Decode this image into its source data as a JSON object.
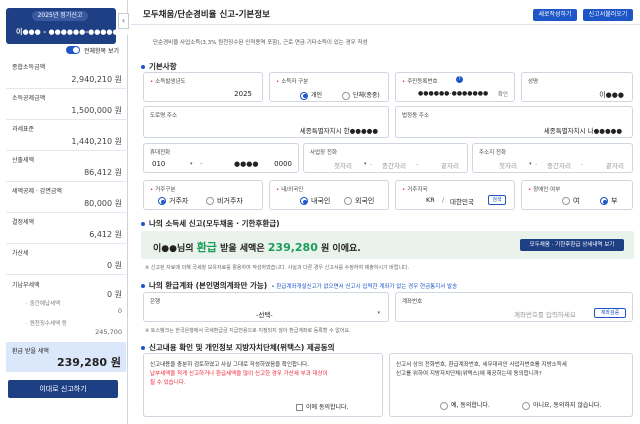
{
  "sidebar": {
    "period_badge": "2025년 정기신고",
    "user_masked": "이●●● - ●●●●●●-●●●●●●●",
    "collapse_icon": "‹",
    "toggle_label": "전체항목 보기",
    "items": [
      {
        "label": "종합소득금액",
        "value": "2,940,210 원"
      },
      {
        "label": "소득공제금액",
        "value": "1,500,000 원"
      },
      {
        "label": "과세표준",
        "value": "1,440,210 원"
      },
      {
        "label": "산출세액",
        "value": "86,412 원"
      },
      {
        "label": "세액공제 · 감면금액",
        "value": "80,000 원"
      },
      {
        "label": "결정세액",
        "value": "6,412 원"
      },
      {
        "label": "가산세",
        "value": "0 원"
      }
    ],
    "prepaid": {
      "label": "기납부세액",
      "value": "0 원",
      "sub1_label": "중간예납세액",
      "sub1_value": "0",
      "sub2_label": "원천징수세액 등",
      "sub2_value": "245,700"
    },
    "refund_label": "환급 받을 세액",
    "refund_value": "239,280 원",
    "submit_label": "이대로 신고하기"
  },
  "header": {
    "title": "모두채움/단순경비율 신고-기본정보",
    "btn_rewrite": "새로작성하기",
    "btn_load": "신고서불러오기"
  },
  "description": "단순경비율 사업소득(3.3% 원천징수된 인적용역 포함), 근로·연금·기타소득이 있는 경우 작성",
  "basic": {
    "section_title": "기본사항",
    "year_label": "소득발생년도",
    "year_value": "2025",
    "filer_type_label": "소득자 구분",
    "filer_type_options": [
      "개인",
      "단체(종중)"
    ],
    "rrn_label": "주민등록번호",
    "rrn_value": "●●●●●●-●●●●●●●",
    "rrn_confirm": "확인",
    "name_label": "성명",
    "name_value": "이●●●",
    "road_addr_label": "도로명 주소",
    "road_addr_value": "세종특별자치시 한●●●●●",
    "legal_addr_label": "법정동 주소",
    "legal_addr_value": "세종특별자치시 나●●●●●",
    "mobile_label": "휴대전화",
    "mobile_p1": "010",
    "mobile_p2": "●●●●",
    "mobile_p3": "0000",
    "biz_phone_label": "사업장 전화",
    "home_phone_label": "주소지 전화",
    "ph_area": "첫자리",
    "ph_mid": "중간자리",
    "ph_last": "끝자리",
    "residence_label": "거주구분",
    "residence_options": [
      "거주자",
      "비거주자"
    ],
    "nationality_label": "내/외국인",
    "nationality_options": [
      "내국인",
      "외국인"
    ],
    "country_label": "거주지국",
    "country_code": "KR",
    "country_name": "대한민국",
    "country_search": "검색",
    "disabled_label": "장애인 여부",
    "disabled_options": [
      "여",
      "부"
    ]
  },
  "refund_section": {
    "title": "나의 소득세 신고(모두채움 · 기한후환급)",
    "result_text": "이●●님의",
    "result_hl": "환급",
    "result_mid": "받을 세액은",
    "result_amount": "239,280",
    "result_suffix": "원 이에요.",
    "detail_btn": "모두채움 · 기한후환급 상세내역 보기",
    "note": "신고된 자료에 의해 국세청 보유자료를 활용하여 작성하였습니다. 사실과 다른 경우 신고서를 수정하여 제출하시기 바랍니다."
  },
  "account": {
    "title": "나의 환급계좌 (본인명의계좌만 가능)",
    "hint": "환급계좌개설신고가 없으면서 신고시 입력한 계좌가 없는 경우 현금통지서 발송",
    "bank_label": "은행",
    "bank_select": "-선택-",
    "acct_label": "계좌번호",
    "acct_placeholder": "계좌번호를 입력하세요",
    "acct_check": "계좌검증",
    "note": "토스뱅크는 한국은행에서 국세환급금 지급전용으로 지정되지 않아 환급계좌로 등록할 수 없어요."
  },
  "consent": {
    "title": "신고내용 확인 및 개인정보 지방자치단체(위택스) 제공동의",
    "left_line1": "신고내용을 충분히 검토하였고 사실 그대로 작성하였음을 확인합니다.",
    "left_line2": "납부세액을 적게 신고하거나 환급세액을 많이 신고한 경우 가산세 부과 대상이",
    "left_line3": "될 수 있습니다.",
    "left_check": "이에 동의합니다.",
    "right_line1": "신고서 상의 전화번호, 환급계좌번호, 세무대리인 사업자번호를 지방소득세",
    "right_line2": "신고를 위하여 지방자치단체(위택스)에 제공하는데 동의합니까?",
    "right_yes": "예, 동의합니다.",
    "right_no": "아니요, 동의하지 않습니다."
  }
}
